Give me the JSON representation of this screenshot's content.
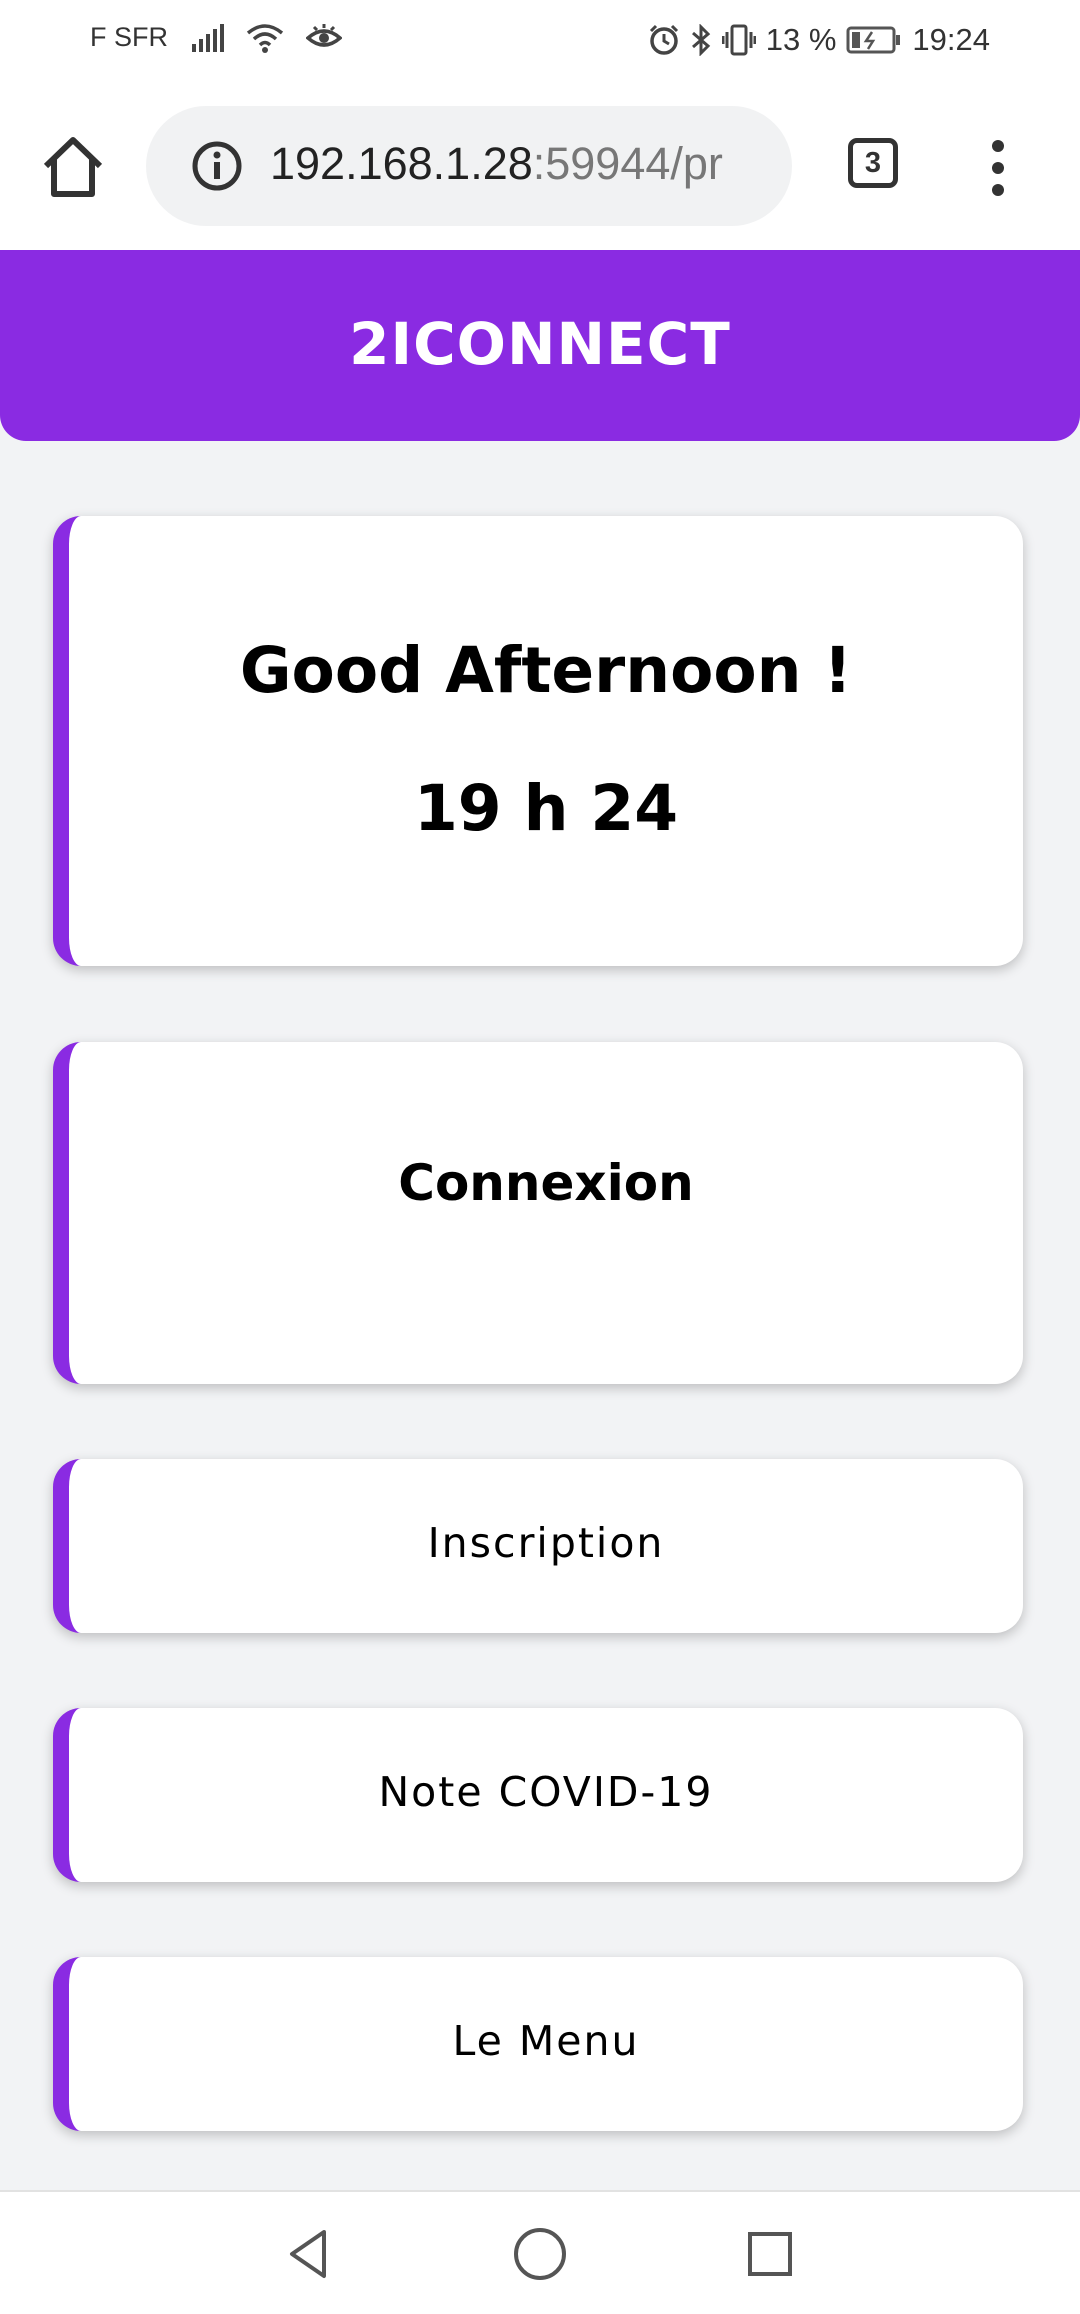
{
  "status_bar": {
    "carrier": "F SFR",
    "battery_percent": "13 %",
    "time": "19:24",
    "icons": [
      "signal-icon",
      "wifi-icon",
      "eye-icon",
      "alarm-icon",
      "bluetooth-icon",
      "vibrate-icon",
      "battery-icon"
    ]
  },
  "browser": {
    "url_host": "192.168.1.28",
    "url_rest": ":59944/pr",
    "tab_count": "3",
    "icons": [
      "home-icon",
      "info-icon",
      "tabs-icon",
      "more-vert-icon"
    ]
  },
  "header": {
    "title": "2ICONNECT",
    "accent_color": "#8a2be2"
  },
  "greeting": {
    "title": "Good Afternoon !",
    "time": "19 h 24"
  },
  "cards": {
    "connexion": "Connexion",
    "inscription": "Inscription",
    "covid": "Note COVID-19",
    "menu": "Le Menu"
  },
  "nav": {
    "icons": [
      "back-icon",
      "home-circle-icon",
      "recents-icon"
    ]
  }
}
